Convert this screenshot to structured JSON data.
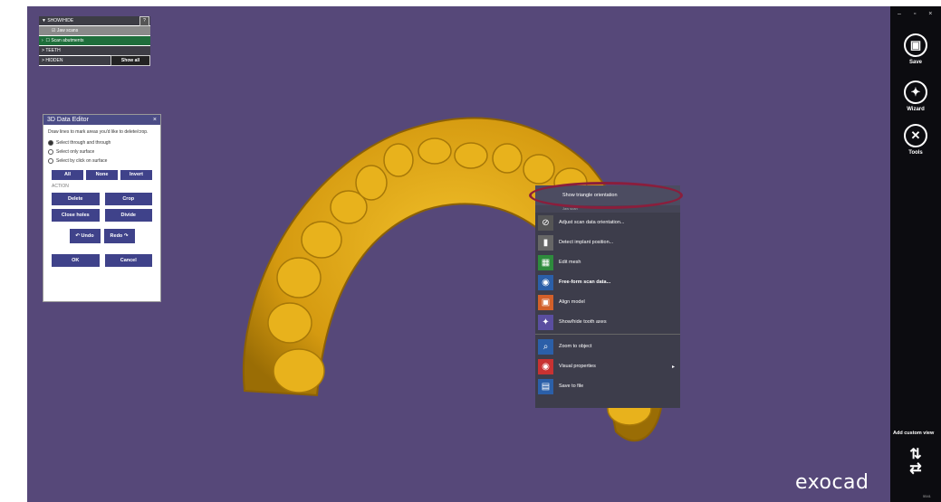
{
  "window_controls": "– ▫ ×",
  "show_hide_panel": {
    "header": "SHOW/HIDE",
    "help": "?",
    "rows": [
      {
        "label": "Jaw scans",
        "checked": true
      },
      {
        "label": "Scan abutments",
        "checked": false
      }
    ],
    "teeth": "TEETH",
    "hidden": "HIDDEN",
    "show_all": "Show all"
  },
  "editor": {
    "title": "3D Data Editor",
    "close": "×",
    "description": "Draw lines to mark areas you'd like to delete/crop.",
    "options": [
      {
        "label": "Select through and through",
        "selected": true
      },
      {
        "label": "Select only surface",
        "selected": false
      },
      {
        "label": "Select by click on surface",
        "selected": false
      }
    ],
    "select_buttons": [
      "All",
      "None",
      "Invert"
    ],
    "action_label": "ACTION",
    "action_buttons": [
      "Delete",
      "Crop",
      "Close holes",
      "Divide"
    ],
    "undo": "Undo",
    "redo": "Redo",
    "ok": "OK",
    "cancel": "Cancel"
  },
  "context_menu": {
    "top_item": "Show triangle orientation",
    "sub_text": "Jaw scan",
    "items": [
      {
        "label": "Adjust scan data orientation...",
        "icon": "orientation-icon",
        "color": "#555"
      },
      {
        "label": "Detect implant position...",
        "icon": "implant-icon",
        "color": "#666"
      },
      {
        "label": "Edit mesh",
        "icon": "mesh-icon",
        "color": "#2e8b3d"
      },
      {
        "label": "Free-form scan data...",
        "icon": "freeform-icon",
        "color": "#2b5fa8",
        "bold": true
      },
      {
        "label": "Align model",
        "icon": "align-icon",
        "color": "#d2602a"
      },
      {
        "label": "Show/hide tooth axes",
        "icon": "axes-icon",
        "color": "#5a4ea0"
      },
      {
        "label": "Zoom to object",
        "icon": "zoom-icon",
        "color": "#2b5fa8",
        "sep_before": true
      },
      {
        "label": "Visual properties",
        "icon": "eye-icon",
        "color": "#c83232",
        "submenu": true
      },
      {
        "label": "Save to file",
        "icon": "save-icon",
        "color": "#2b5fa8"
      }
    ]
  },
  "right_bar": {
    "save": "Save",
    "wizard": "Wizard",
    "tools": "Tools",
    "add_custom_view": "Add custom view"
  },
  "logo": "exocad",
  "version": "5541"
}
